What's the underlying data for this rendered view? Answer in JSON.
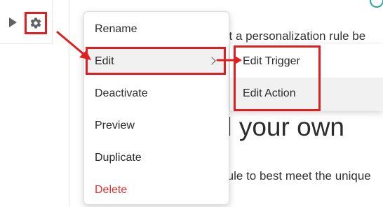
{
  "background": {
    "line_1": "ct a personalization rule be",
    "heading": "d your own",
    "line_2": "rule to best meet the unique"
  },
  "context_menu": {
    "items": [
      {
        "label": "Rename"
      },
      {
        "label": "Edit"
      },
      {
        "label": "Deactivate"
      },
      {
        "label": "Preview"
      },
      {
        "label": "Duplicate"
      },
      {
        "label": "Delete"
      }
    ]
  },
  "submenu": {
    "items": [
      {
        "label": "Edit Trigger"
      },
      {
        "label": "Edit Action"
      }
    ]
  },
  "colors": {
    "annotation_red": "#e02020",
    "delete_red": "#e5322d",
    "accent_teal": "#2aa8a0",
    "hover_gray": "#f1f1f1"
  },
  "icons": [
    "expand-arrow-icon",
    "gear-icon",
    "chevron-right-icon"
  ]
}
